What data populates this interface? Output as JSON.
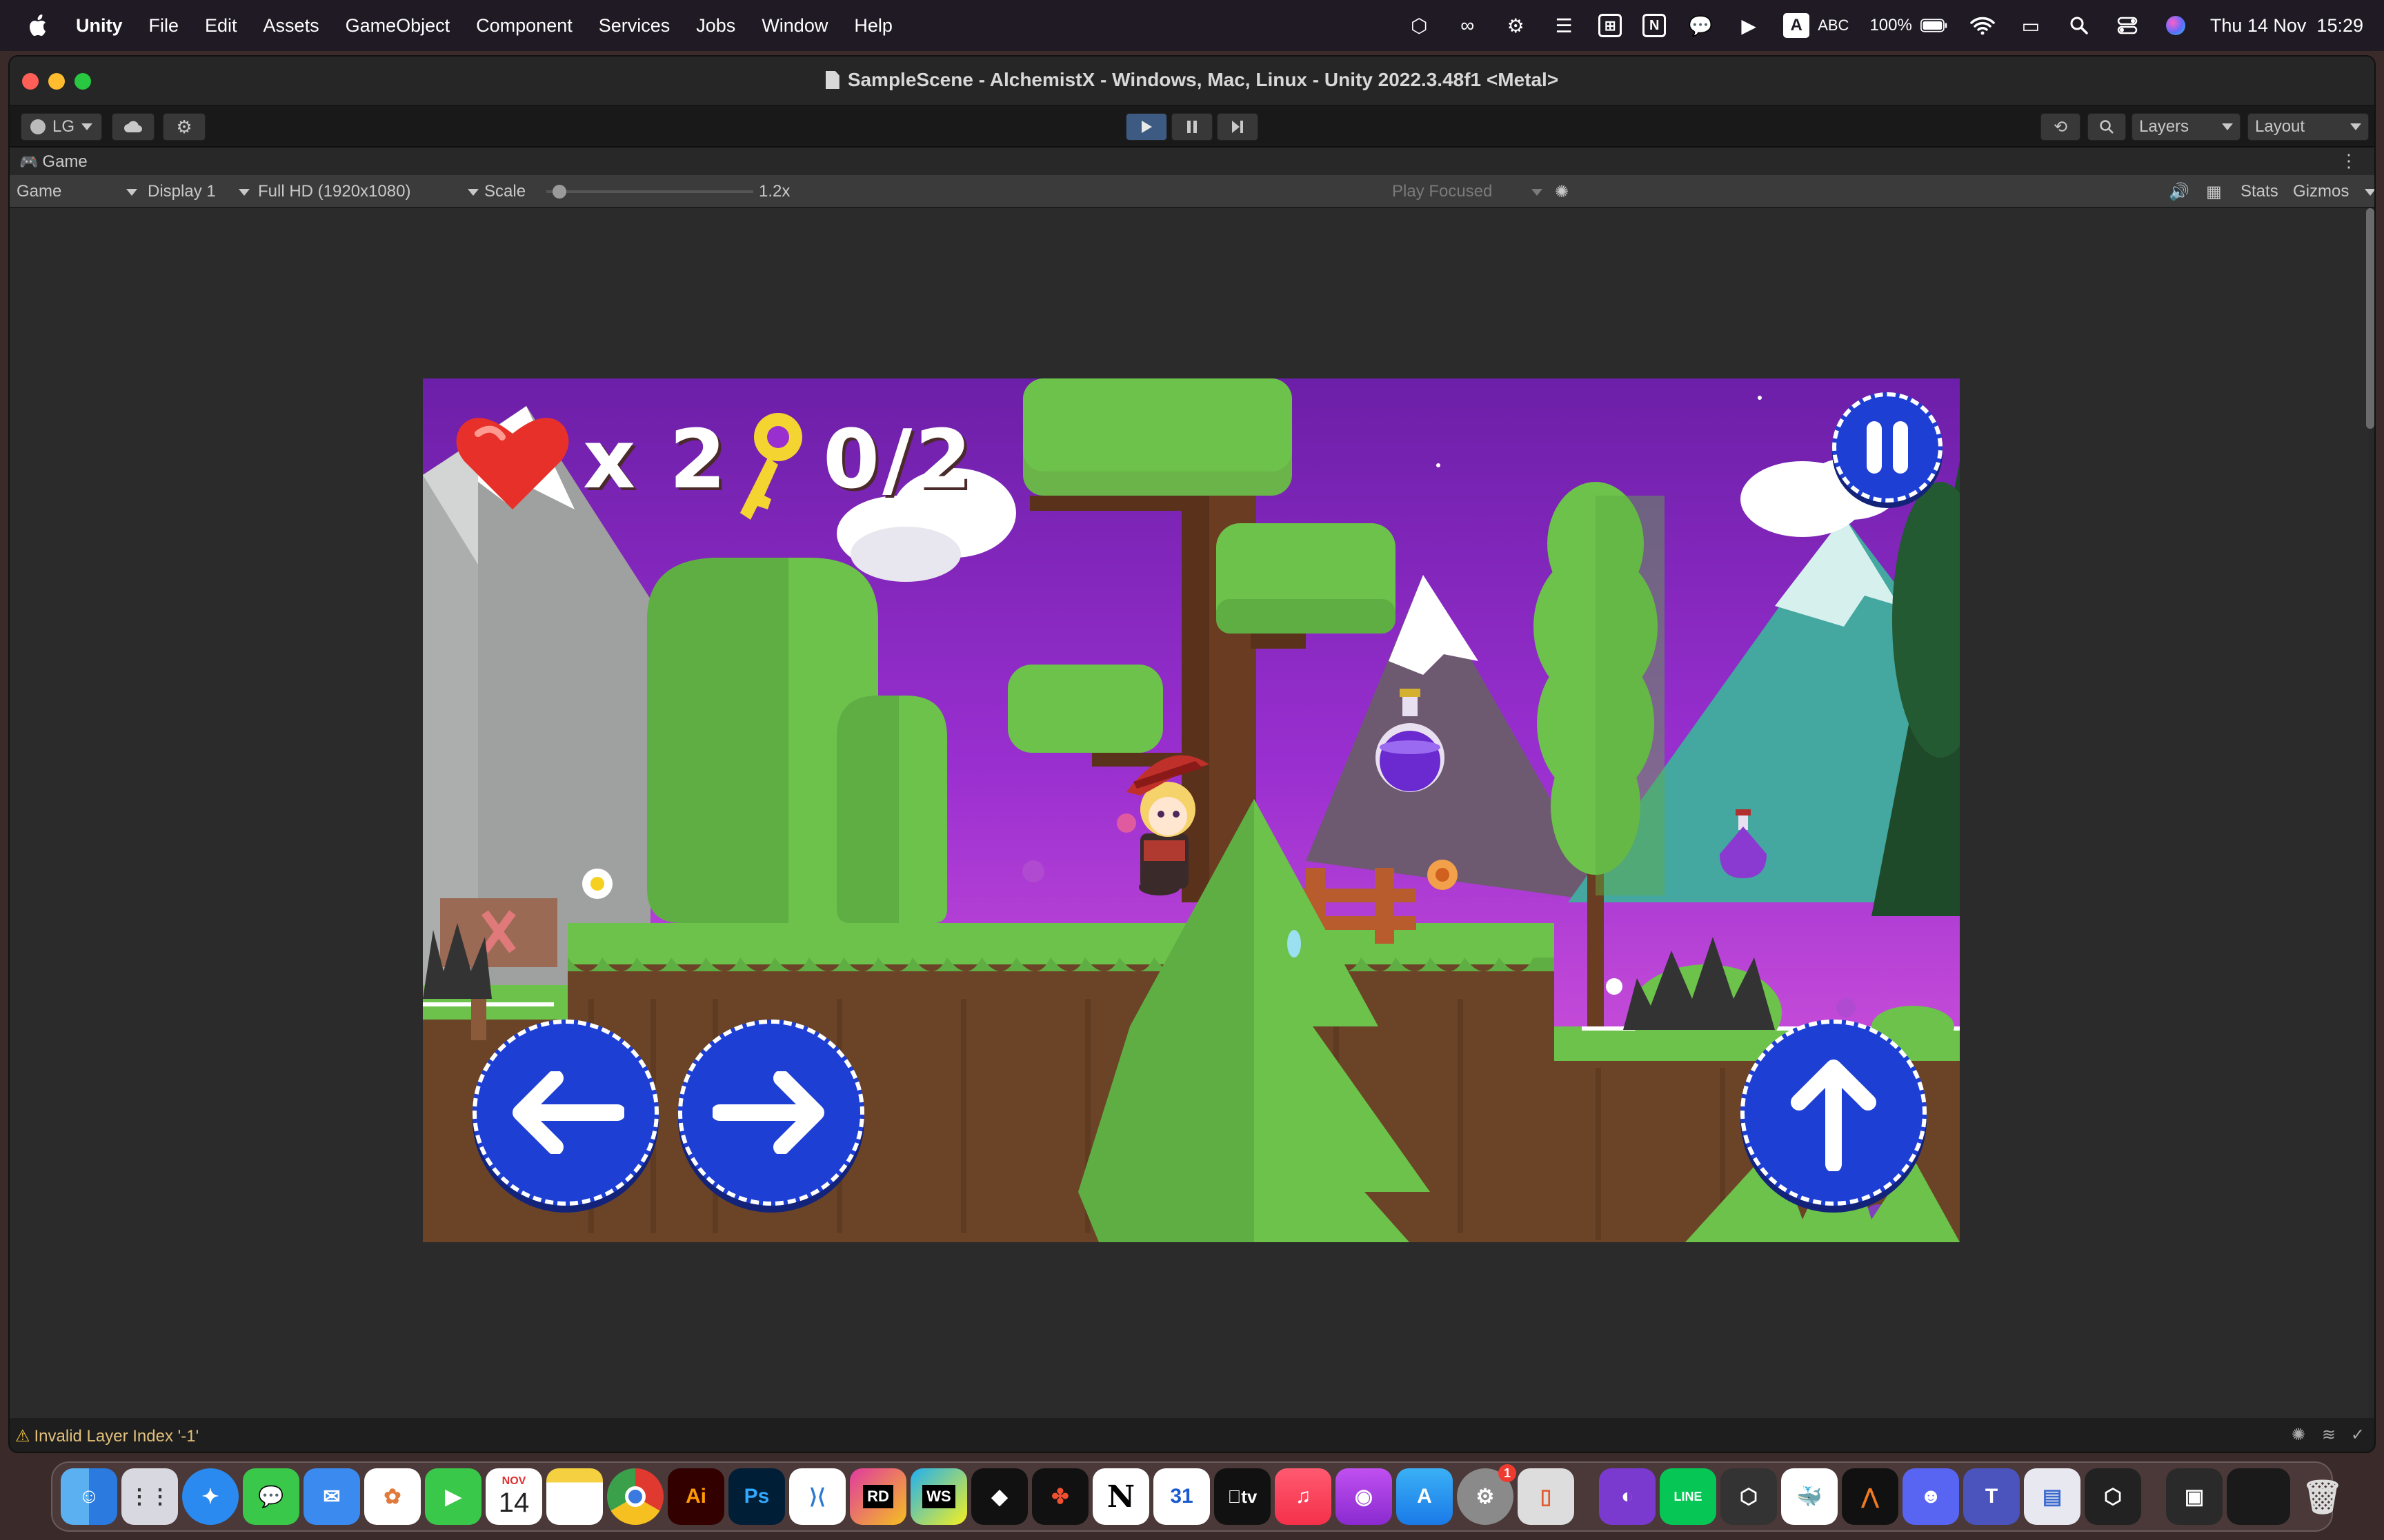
{
  "menubar": {
    "app_name": "Unity",
    "items": [
      "File",
      "Edit",
      "Assets",
      "GameObject",
      "Component",
      "Services",
      "Jobs",
      "Window",
      "Help"
    ],
    "status": {
      "keyboard_badge": "A",
      "keyboard_label": "ABC",
      "battery": "100%",
      "datetime": "Thu 14 Nov  15:29"
    }
  },
  "window": {
    "title": "SampleScene - AlchemistX - Windows, Mac, Linux - Unity 2022.3.48f1 <Metal>",
    "toolbar": {
      "account": "LG",
      "layers": "Layers",
      "layout": "Layout"
    },
    "tab": {
      "label": "Game"
    },
    "gamebar": {
      "mode": "Game",
      "display": "Display 1",
      "resolution": "Full HD (1920x1080)",
      "scale_label": "Scale",
      "scale_value": "1.2x",
      "scale_fraction": 0.03,
      "play_focused": "Play Focused",
      "stats": "Stats",
      "gizmos": "Gizmos"
    },
    "status": {
      "warning": "Invalid Layer Index '-1'"
    }
  },
  "game": {
    "lives": "x 2",
    "keys": "0/2"
  },
  "dock": {
    "calendar_month": "NOV",
    "calendar_day": "14",
    "gcal_day": "31",
    "badge_settings": "1",
    "apps": [
      "finder-icon",
      "launchpad-icon",
      "safari-icon",
      "messages-icon",
      "mail-icon",
      "photos-icon",
      "facetime-icon",
      "calendar-icon",
      "notes-icon",
      "chrome-icon",
      "illustrator-icon",
      "photoshop-icon",
      "vscode-icon",
      "rider-icon",
      "webstorm-icon",
      "unity-hub-icon",
      "figma-icon",
      "notion-icon",
      "google-calendar-icon",
      "apple-tv-icon",
      "music-icon",
      "podcasts-icon",
      "app-store-icon",
      "system-settings-icon",
      "iphone-mirroring-icon",
      "github-desktop-icon",
      "line-icon",
      "unity-icon",
      "docker-icon",
      "altair-icon",
      "discord-icon",
      "teams-icon",
      "preview-icon",
      "unity-editor-icon",
      "screenshot-icon",
      "window-thumbnail-icon",
      "trash-icon"
    ],
    "labels": {
      "ai": "Ai",
      "ps": "Ps",
      "rd": "RD",
      "ws": "WS",
      "tv": "tv",
      "line": "LINE"
    }
  },
  "colors": {
    "accent_blue": "#1d3fd4",
    "grass": "#6cc24a",
    "dirt": "#6b4428",
    "sky_purple": "#9a2fd0"
  }
}
